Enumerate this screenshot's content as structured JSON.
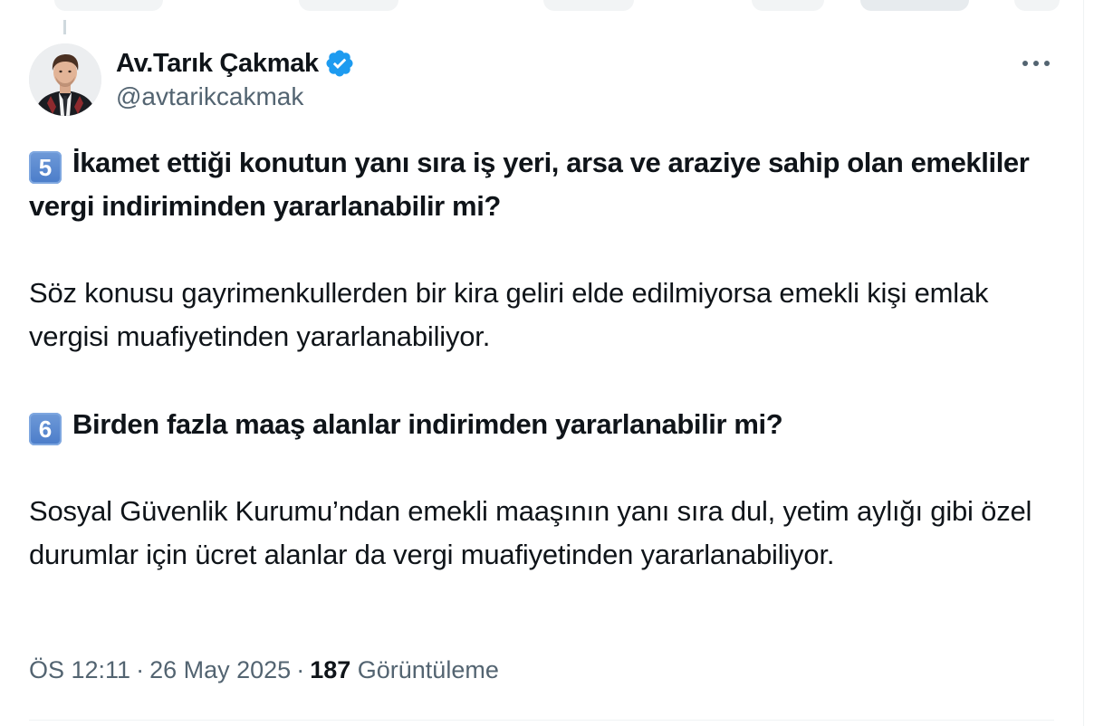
{
  "author": {
    "name": "Av.Tarık Çakmak",
    "handle": "@avtarikcakmak",
    "verified": true,
    "verified_color": "#1d9bf0"
  },
  "tweet": {
    "q5_number": "5",
    "q5_text": "İkamet ettiği konutun yanı sıra iş yeri, arsa ve araziye sahip olan emekliler vergi indiriminden yararlanabilir mi?",
    "a5_text": "Söz konusu gayrimenkullerden bir kira geliri elde edilmiyorsa emekli kişi emlak vergisi muafiyetinden yararlanabiliyor.",
    "q6_number": "6",
    "q6_text": "Birden fazla maaş alanlar indirimden yararlanabilir mi?",
    "a6_text": "Sosyal Güvenlik Kurumu’ndan emekli maaşının yanı sıra dul, yetim aylığı gibi özel durumlar için ücret alanlar da vergi muafiyetinden yararlanabiliyor."
  },
  "meta": {
    "time": "ÖS 12:11",
    "separator": "·",
    "date": "26 May 2025",
    "views_count": "187",
    "views_label": "Görüntüleme"
  },
  "icons": {
    "more": "more-horizontal-icon",
    "verified": "verified-badge-icon"
  },
  "colors": {
    "text_primary": "#0f1419",
    "text_secondary": "#536471",
    "keycap_blue": "#4a7cc9"
  }
}
